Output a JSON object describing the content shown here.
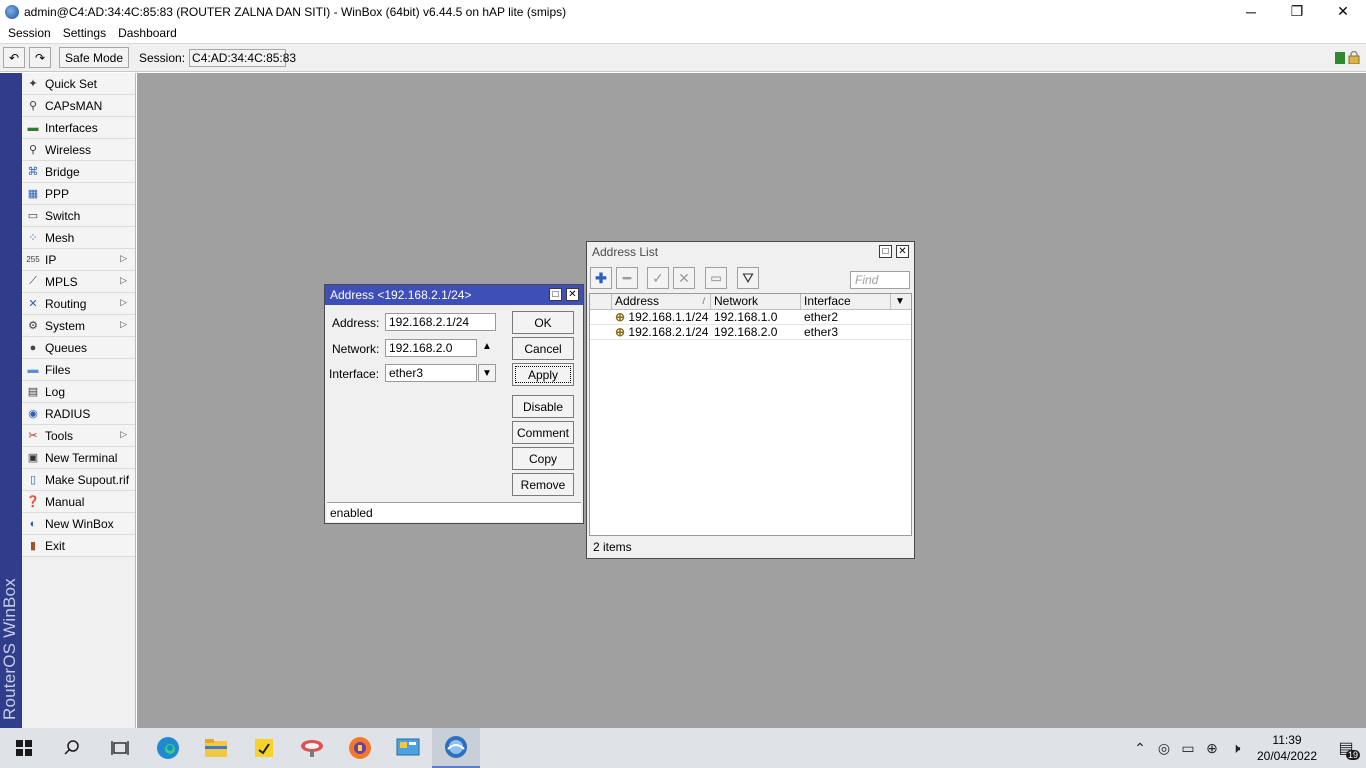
{
  "window": {
    "title": "admin@C4:AD:34:4C:85:83 (ROUTER ZALNA DAN SITI) - WinBox (64bit) v6.44.5 on hAP lite (smips)",
    "minimize": "─",
    "restore": "❐",
    "close": "✕"
  },
  "menu": [
    "Session",
    "Settings",
    "Dashboard"
  ],
  "toolbar": {
    "undo": "↶",
    "redo": "↷",
    "safe_mode": "Safe Mode",
    "session_label": "Session:",
    "session_value": "C4:AD:34:4C:85:83"
  },
  "brand": "RouterOS WinBox",
  "sidebar": {
    "items": [
      {
        "label": "Quick Set",
        "icon": "quick-set-icon",
        "arrow": ""
      },
      {
        "label": "CAPsMAN",
        "icon": "capsman-icon",
        "arrow": ""
      },
      {
        "label": "Interfaces",
        "icon": "interfaces-icon",
        "arrow": ""
      },
      {
        "label": "Wireless",
        "icon": "wireless-icon",
        "arrow": ""
      },
      {
        "label": "Bridge",
        "icon": "bridge-icon",
        "arrow": ""
      },
      {
        "label": "PPP",
        "icon": "ppp-icon",
        "arrow": ""
      },
      {
        "label": "Switch",
        "icon": "switch-icon",
        "arrow": ""
      },
      {
        "label": "Mesh",
        "icon": "mesh-icon",
        "arrow": ""
      },
      {
        "label": "IP",
        "icon": "ip-icon",
        "arrow": "▷"
      },
      {
        "label": "MPLS",
        "icon": "mpls-icon",
        "arrow": "▷"
      },
      {
        "label": "Routing",
        "icon": "routing-icon",
        "arrow": "▷"
      },
      {
        "label": "System",
        "icon": "system-icon",
        "arrow": "▷"
      },
      {
        "label": "Queues",
        "icon": "queues-icon",
        "arrow": ""
      },
      {
        "label": "Files",
        "icon": "files-icon",
        "arrow": ""
      },
      {
        "label": "Log",
        "icon": "log-icon",
        "arrow": ""
      },
      {
        "label": "RADIUS",
        "icon": "radius-icon",
        "arrow": ""
      },
      {
        "label": "Tools",
        "icon": "tools-icon",
        "arrow": "▷"
      },
      {
        "label": "New Terminal",
        "icon": "terminal-icon",
        "arrow": ""
      },
      {
        "label": "Make Supout.rif",
        "icon": "supout-icon",
        "arrow": ""
      },
      {
        "label": "Manual",
        "icon": "manual-icon",
        "arrow": ""
      },
      {
        "label": "New WinBox",
        "icon": "winbox-icon",
        "arrow": ""
      },
      {
        "label": "Exit",
        "icon": "exit-icon",
        "arrow": ""
      }
    ]
  },
  "address_dialog": {
    "title": "Address <192.168.2.1/24>",
    "address_label": "Address:",
    "address_value": "192.168.2.1/24",
    "network_label": "Network:",
    "network_value": "192.168.2.0",
    "interface_label": "Interface:",
    "interface_value": "ether3",
    "buttons": [
      "OK",
      "Cancel",
      "Apply",
      "Disable",
      "Comment",
      "Copy",
      "Remove"
    ],
    "status": "enabled"
  },
  "address_list": {
    "title": "Address List",
    "find_placeholder": "Find",
    "columns": [
      "Address",
      "Network",
      "Interface"
    ],
    "sort_marker": "/",
    "rows": [
      {
        "address": "192.168.1.1/24",
        "network": "192.168.1.0",
        "interface": "ether2"
      },
      {
        "address": "192.168.2.1/24",
        "network": "192.168.2.0",
        "interface": "ether3"
      }
    ],
    "count": "2 items"
  },
  "taskbar": {
    "time": "11:39",
    "date": "20/04/2022",
    "notification_count": "19"
  },
  "colors": {
    "brand_bar": "#2f3d8a",
    "dialog_title_active": "#3f4fb8",
    "workspace": "#a0a0a0"
  }
}
